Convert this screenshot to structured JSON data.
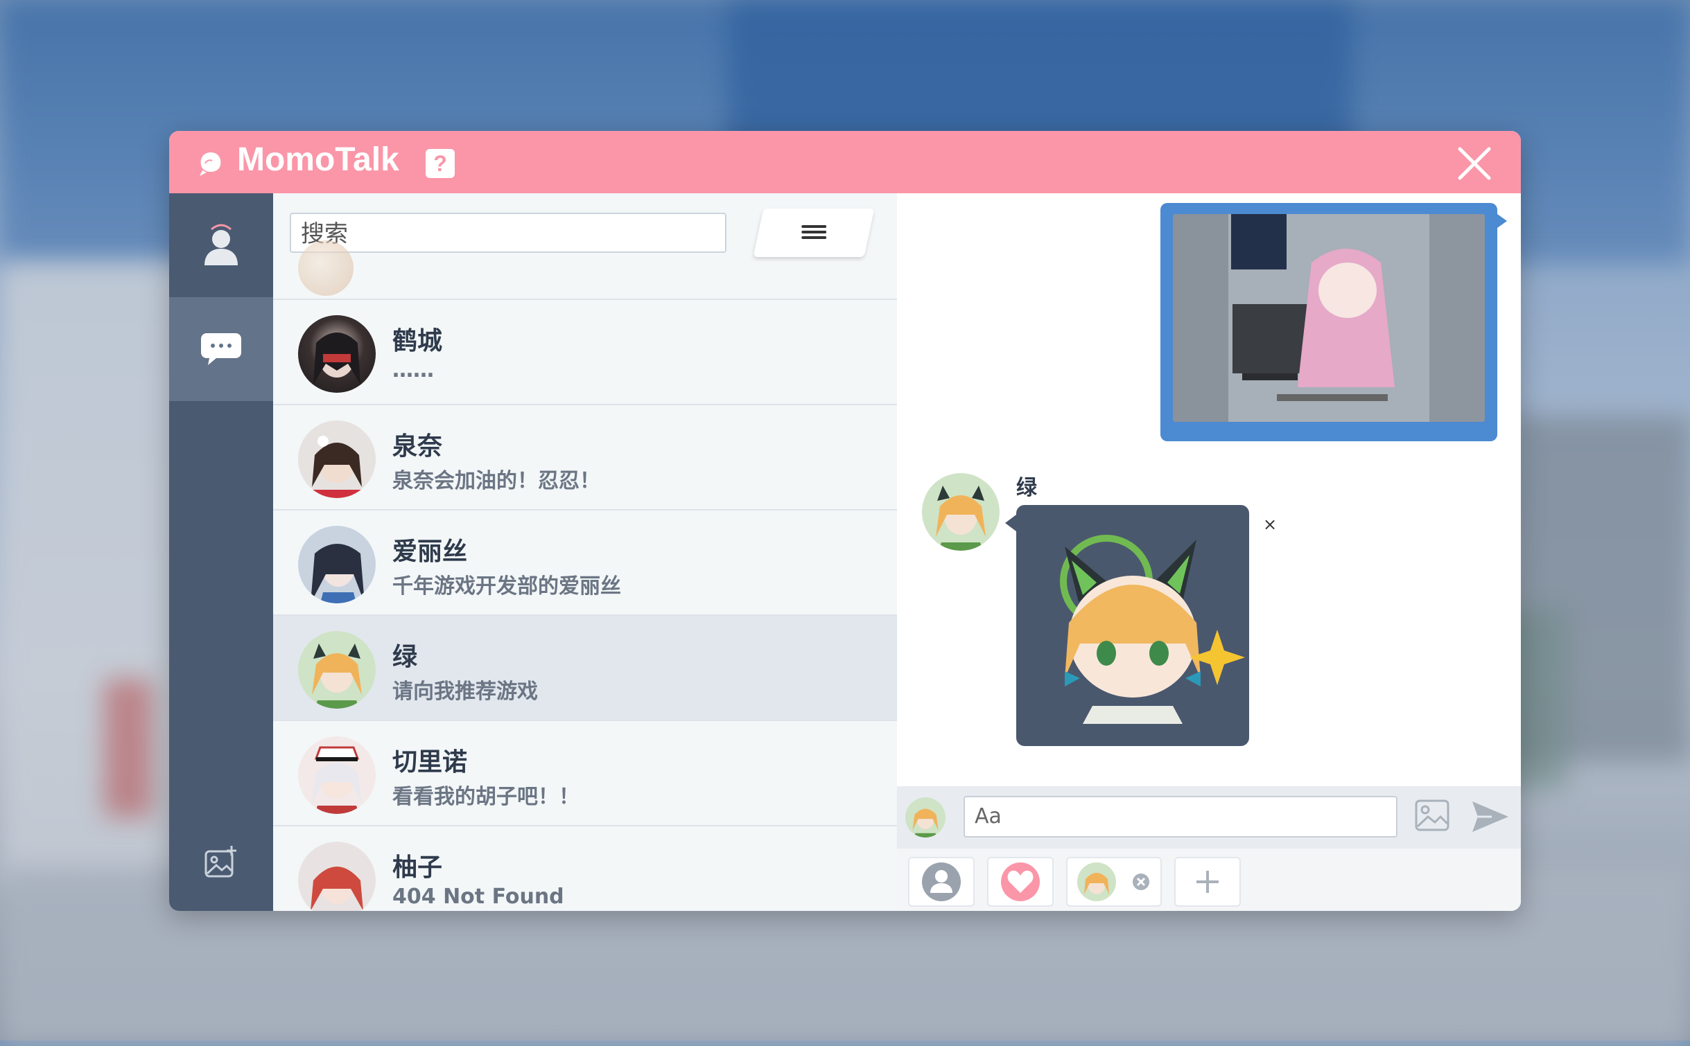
{
  "app": {
    "title": "MomoTalk",
    "help": "?"
  },
  "search": {
    "placeholder": "搜索"
  },
  "contacts": [
    {
      "name": "鹤城",
      "message": "……"
    },
    {
      "name": "泉奈",
      "message": "泉奈会加油的！忍忍！"
    },
    {
      "name": "爱丽丝",
      "message": "千年游戏开发部的爱丽丝"
    },
    {
      "name": "绿",
      "message": "请向我推荐游戏",
      "selected": true
    },
    {
      "name": "切里诺",
      "message": "看看我的胡子吧！！"
    },
    {
      "name": "柚子",
      "message": "404 Not Found"
    }
  ],
  "chat": {
    "recipient_name": "绿",
    "input_placeholder": "Aa",
    "remove_label": "×"
  },
  "colors": {
    "titlebar": "#fa96a8",
    "sidebar": "#4a5a71",
    "sidebar_active": "#637389",
    "sent_bubble": "#4c8ad2",
    "sticker_bg": "#4a586e"
  }
}
